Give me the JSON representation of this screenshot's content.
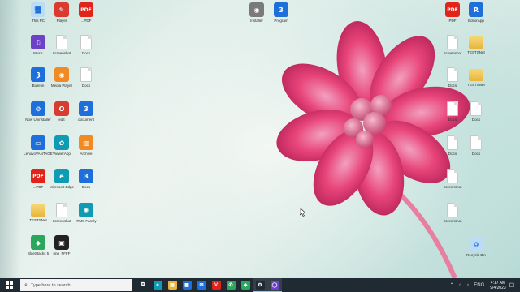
{
  "colors": {
    "taskbar": "#1f2a33",
    "flower": "#e8457a",
    "wallpaper": "#cfe6e0"
  },
  "desktop_icons": [
    {
      "label": "This PC",
      "icon": "this-pc-icon",
      "glyph": "🖥",
      "color": "mono"
    },
    {
      "label": "Music",
      "icon": "itunes-icon",
      "glyph": "♫",
      "color": "purple"
    },
    {
      "label": "Bulletin",
      "icon": "app-icon",
      "glyph": "Ȝ",
      "color": "blue"
    },
    {
      "label": "Now Uninstaller",
      "icon": "uninstaller-icon",
      "glyph": "⚙",
      "color": "blue"
    },
    {
      "label": "LenovoVANTAGE",
      "icon": "monitor-icon",
      "glyph": "▭",
      "color": "blue"
    },
    {
      "label": "...PDF",
      "icon": "pdf-icon",
      "glyph": "PDF",
      "color": "pdf"
    },
    {
      "label": "TESTSNet",
      "icon": "folder-icon",
      "glyph": "",
      "color": "folder"
    },
    {
      "label": "BlueStacks 5",
      "icon": "bluestacks-icon",
      "glyph": "◆",
      "color": "green"
    },
    {
      "label": "Player",
      "icon": "player-icon",
      "glyph": "✎",
      "color": "red"
    },
    {
      "label": "Screenshot",
      "icon": "document-icon",
      "glyph": "",
      "color": "doc"
    },
    {
      "label": "Media Player",
      "icon": "media-icon",
      "glyph": "◉",
      "color": "orange"
    },
    {
      "label": "edit",
      "icon": "office-icon",
      "glyph": "O",
      "color": "red"
    },
    {
      "label": "ViewerApp",
      "icon": "app-icon",
      "glyph": "✿",
      "color": "teal"
    },
    {
      "label": "Microsoft Edge",
      "icon": "edge-icon",
      "glyph": "e",
      "color": "teal"
    },
    {
      "label": "Screenshot",
      "icon": "document-icon",
      "glyph": "",
      "color": "doc"
    },
    {
      "label": "png_FFFF",
      "icon": "image-icon",
      "glyph": "▣",
      "color": "dark"
    },
    {
      "label": "...PDF",
      "icon": "pdf-icon",
      "glyph": "PDF",
      "color": "pdf"
    },
    {
      "label": "Docs",
      "icon": "document-icon",
      "glyph": "",
      "color": "doc"
    },
    {
      "label": "Docs",
      "icon": "document-icon",
      "glyph": "",
      "color": "doc"
    },
    {
      "label": "document",
      "icon": "app-icon",
      "glyph": "3",
      "color": "blue"
    },
    {
      "label": "Archive",
      "icon": "archive-icon",
      "glyph": "▥",
      "color": "orange"
    },
    {
      "label": "Docs",
      "icon": "app-icon",
      "glyph": "3",
      "color": "blue"
    },
    {
      "label": "ITMS Family",
      "icon": "gear-icon",
      "glyph": "✺",
      "color": "teal"
    },
    {
      "label": "Installer",
      "icon": "installer-icon",
      "glyph": "◉",
      "color": "gray"
    },
    {
      "label": "Program",
      "icon": "app-icon",
      "glyph": "3",
      "color": "blue"
    },
    {
      "label": "PDF",
      "icon": "pdf-icon",
      "glyph": "PDF",
      "color": "pdf"
    },
    {
      "label": "Screenshot",
      "icon": "document-icon",
      "glyph": "",
      "color": "doc"
    },
    {
      "label": "Docs",
      "icon": "document-icon",
      "glyph": "",
      "color": "doc"
    },
    {
      "label": "Docs",
      "icon": "document-icon",
      "glyph": "",
      "color": "doc"
    },
    {
      "label": "Docs",
      "icon": "document-icon",
      "glyph": "",
      "color": "doc"
    },
    {
      "label": "Screenshot",
      "icon": "document-icon",
      "glyph": "",
      "color": "doc"
    },
    {
      "label": "Screenshot",
      "icon": "document-icon",
      "glyph": "",
      "color": "doc"
    },
    {
      "label": "EditorApp",
      "icon": "app-icon",
      "glyph": "R",
      "color": "blue"
    },
    {
      "label": "TESTSNet",
      "icon": "folder-icon",
      "glyph": "",
      "color": "folder"
    },
    {
      "label": "TESTSNet",
      "icon": "folder-icon",
      "glyph": "",
      "color": "folder"
    },
    {
      "label": "Docs",
      "icon": "document-icon",
      "glyph": "",
      "color": "doc"
    },
    {
      "label": "Docs",
      "icon": "document-icon",
      "glyph": "",
      "color": "doc"
    },
    {
      "label": "Recycle Bin",
      "icon": "recycle-bin-icon",
      "glyph": "♻",
      "color": "mono"
    }
  ],
  "taskbar": {
    "search_placeholder": "Type here to search",
    "apps": [
      {
        "name": "task-view",
        "glyph": "⧉",
        "color": "#1f2a33"
      },
      {
        "name": "edge",
        "glyph": "e",
        "color": "#0f9bb3"
      },
      {
        "name": "file-explorer",
        "glyph": "▤",
        "color": "#e7b53c"
      },
      {
        "name": "store",
        "glyph": "▦",
        "color": "#1e6fd9"
      },
      {
        "name": "mail",
        "glyph": "✉",
        "color": "#1e6fd9"
      },
      {
        "name": "vivaldi",
        "glyph": "V",
        "color": "#e2231a"
      },
      {
        "name": "whatsapp",
        "glyph": "✆",
        "color": "#2aa65d"
      },
      {
        "name": "app-green",
        "glyph": "◆",
        "color": "#2aa65d"
      },
      {
        "name": "settings",
        "glyph": "⚙",
        "color": "#1f2a33"
      },
      {
        "name": "app-circle",
        "glyph": "◯",
        "color": "#6d42c8"
      }
    ],
    "tray": {
      "language": "ENG",
      "time": "4:17 AM",
      "date": "9/4/2023"
    }
  }
}
